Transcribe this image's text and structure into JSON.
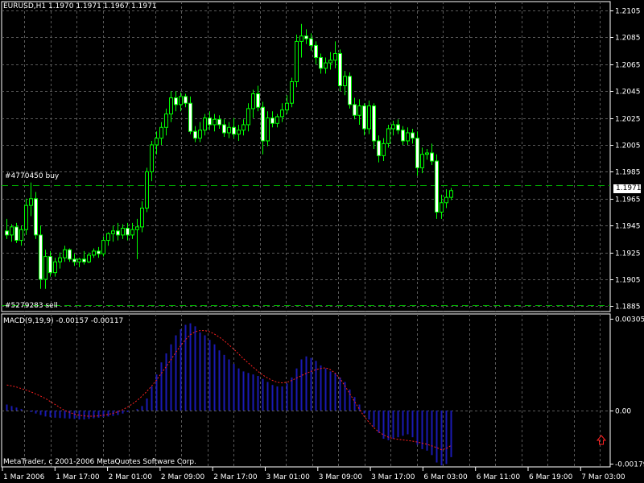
{
  "header": {
    "symbol_info": "EURUSD,H1  1.1970 1.1971 1.1967 1.1971"
  },
  "orders": {
    "buy": "#4770450 buy",
    "sell": "#5279283 sell"
  },
  "current_price": "1.1971",
  "indicator": {
    "title": "MACD(9,19,9) -0.00157 -0.00117"
  },
  "copyright": "MetaTrader, c 2001-2006 MetaQuotes Software Corp.",
  "colors": {
    "background": "#000000",
    "grid": "#5a5a5a",
    "bull_body": "#000000",
    "bear_body": "#ffffff",
    "wick": "#00ff00",
    "order_line": "#00aa00",
    "histogram": "#1a1ab4",
    "signal": "#ff2020",
    "arrow": "#ff2020"
  },
  "chart_data": [
    {
      "type": "candlestick",
      "title": "EURUSD,H1",
      "ylim": [
        1.1883,
        1.211
      ],
      "y_ticks": [
        "1.2105",
        "1.2085",
        "1.2065",
        "1.2045",
        "1.2025",
        "1.2005",
        "1.1985",
        "1.1965",
        "1.1945",
        "1.1925",
        "1.1905",
        "1.1885"
      ],
      "x_ticks": [
        "1 Mar 2006",
        "1 Mar 17:00",
        "2 Mar 01:00",
        "2 Mar 09:00",
        "2 Mar 17:00",
        "3 Mar 01:00",
        "3 Mar 09:00",
        "3 Mar 17:00",
        "6 Mar 03:00",
        "6 Mar 11:00",
        "6 Mar 19:00",
        "7 Mar 03:00"
      ],
      "order_levels": {
        "buy": 1.1975,
        "sell": 1.1886
      },
      "last_price": 1.1971,
      "candles": [
        [
          1.1941,
          1.195,
          1.1935,
          1.1938
        ],
        [
          1.1938,
          1.1946,
          1.1933,
          1.1944
        ],
        [
          1.1944,
          1.1947,
          1.1932,
          1.1934
        ],
        [
          1.1934,
          1.1945,
          1.193,
          1.1942
        ],
        [
          1.1942,
          1.1965,
          1.1938,
          1.196
        ],
        [
          1.196,
          1.1977,
          1.1952,
          1.1965
        ],
        [
          1.1965,
          1.197,
          1.1935,
          1.1938
        ],
        [
          1.1938,
          1.1945,
          1.1898,
          1.1905
        ],
        [
          1.1905,
          1.1927,
          1.1898,
          1.1922
        ],
        [
          1.1922,
          1.1926,
          1.1907,
          1.191
        ],
        [
          1.191,
          1.1921,
          1.1907,
          1.1918
        ],
        [
          1.1918,
          1.1925,
          1.1913,
          1.1921
        ],
        [
          1.1921,
          1.193,
          1.1918,
          1.1927
        ],
        [
          1.1927,
          1.1928,
          1.1918,
          1.192
        ],
        [
          1.192,
          1.1924,
          1.1915,
          1.1918
        ],
        [
          1.1918,
          1.1921,
          1.1914,
          1.192
        ],
        [
          1.192,
          1.1926,
          1.1916,
          1.1918
        ],
        [
          1.1918,
          1.1925,
          1.1917,
          1.1923
        ],
        [
          1.1923,
          1.1928,
          1.1921,
          1.1926
        ],
        [
          1.1926,
          1.1929,
          1.1921,
          1.1924
        ],
        [
          1.1924,
          1.1937,
          1.1922,
          1.1934
        ],
        [
          1.1934,
          1.194,
          1.193,
          1.1939
        ],
        [
          1.1939,
          1.1945,
          1.1933,
          1.1941
        ],
        [
          1.1941,
          1.1947,
          1.1934,
          1.1938
        ],
        [
          1.1938,
          1.1946,
          1.1935,
          1.1943
        ],
        [
          1.1943,
          1.1947,
          1.1934,
          1.1938
        ],
        [
          1.1938,
          1.1947,
          1.1935,
          1.1942
        ],
        [
          1.1942,
          1.195,
          1.192,
          1.1944
        ],
        [
          1.1944,
          1.1963,
          1.194,
          1.1958
        ],
        [
          1.1958,
          1.1988,
          1.1955,
          1.1985
        ],
        [
          1.1985,
          1.2008,
          1.1978,
          1.2005
        ],
        [
          1.2005,
          1.2015,
          1.1998,
          1.201
        ],
        [
          1.201,
          1.2022,
          1.2005,
          1.2018
        ],
        [
          1.2018,
          1.2032,
          1.2012,
          1.2028
        ],
        [
          1.2028,
          1.2045,
          1.2022,
          1.204
        ],
        [
          1.204,
          1.2045,
          1.203,
          1.2035
        ],
        [
          1.2035,
          1.2044,
          1.203,
          1.2041
        ],
        [
          1.2041,
          1.2043,
          1.2033,
          1.2036
        ],
        [
          1.2036,
          1.2041,
          1.2013,
          1.2015
        ],
        [
          1.2015,
          1.2019,
          1.2007,
          1.201
        ],
        [
          1.201,
          1.2022,
          1.2007,
          1.2016
        ],
        [
          1.2016,
          1.2028,
          1.2012,
          1.2025
        ],
        [
          1.2025,
          1.203,
          1.2016,
          1.202
        ],
        [
          1.202,
          1.2028,
          1.2015,
          1.2024
        ],
        [
          1.2024,
          1.2027,
          1.2017,
          1.202
        ],
        [
          1.202,
          1.2024,
          1.2011,
          1.2014
        ],
        [
          1.2014,
          1.2022,
          1.201,
          1.2018
        ],
        [
          1.2018,
          1.2025,
          1.201,
          1.2013
        ],
        [
          1.2013,
          1.202,
          1.2008,
          1.2016
        ],
        [
          1.2016,
          1.2024,
          1.2012,
          1.202
        ],
        [
          1.202,
          1.2036,
          1.2015,
          1.2032
        ],
        [
          1.2032,
          1.2046,
          1.2025,
          1.2043
        ],
        [
          1.2043,
          1.2049,
          1.203,
          1.2033
        ],
        [
          1.2033,
          1.2037,
          1.1998,
          1.2008
        ],
        [
          1.2008,
          1.203,
          1.2004,
          1.2025
        ],
        [
          1.2025,
          1.203,
          1.2018,
          1.2021
        ],
        [
          1.2021,
          1.2028,
          1.2018,
          1.2026
        ],
        [
          1.2026,
          1.2036,
          1.2022,
          1.2031
        ],
        [
          1.2031,
          1.2042,
          1.2028,
          1.2036
        ],
        [
          1.2036,
          1.2055,
          1.2033,
          1.2052
        ],
        [
          1.2052,
          1.2087,
          1.2048,
          1.2082
        ],
        [
          1.2082,
          1.2095,
          1.207,
          1.2086
        ],
        [
          1.2086,
          1.2091,
          1.208,
          1.2084
        ],
        [
          1.2084,
          1.2088,
          1.2075,
          1.2079
        ],
        [
          1.2079,
          1.2082,
          1.2065,
          1.207
        ],
        [
          1.207,
          1.2073,
          1.2058,
          1.2062
        ],
        [
          1.2062,
          1.207,
          1.2058,
          1.2066
        ],
        [
          1.2066,
          1.2074,
          1.2061,
          1.2068
        ],
        [
          1.2068,
          1.2082,
          1.2062,
          1.2073
        ],
        [
          1.2073,
          1.2076,
          1.2045,
          1.2049
        ],
        [
          1.2049,
          1.206,
          1.2042,
          1.2056
        ],
        [
          1.2056,
          1.2059,
          1.2032,
          1.2035
        ],
        [
          1.2035,
          1.204,
          1.2024,
          1.2027
        ],
        [
          1.2027,
          1.2039,
          1.202,
          1.2034
        ],
        [
          1.2034,
          1.2036,
          1.2012,
          1.2017
        ],
        [
          1.2017,
          1.2038,
          1.2013,
          1.2034
        ],
        [
          1.2034,
          1.2036,
          1.2002,
          1.2008
        ],
        [
          1.2008,
          1.2012,
          1.1992,
          1.1997
        ],
        [
          1.1997,
          1.201,
          1.1993,
          1.2006
        ],
        [
          1.2006,
          1.202,
          1.2003,
          1.2017
        ],
        [
          1.2017,
          1.2023,
          1.2012,
          1.202
        ],
        [
          1.202,
          1.2024,
          1.2013,
          1.2016
        ],
        [
          1.2016,
          1.2019,
          1.2005,
          1.2008
        ],
        [
          1.2008,
          1.2018,
          1.2005,
          1.2014
        ],
        [
          1.2014,
          1.2017,
          1.2006,
          1.201
        ],
        [
          1.201,
          1.2015,
          1.1982,
          1.1988
        ],
        [
          1.1988,
          1.2003,
          1.1984,
          1.1998
        ],
        [
          1.1998,
          1.2002,
          1.1994,
          1.1999
        ],
        [
          1.1999,
          1.2006,
          1.199,
          1.1993
        ],
        [
          1.1993,
          1.1998,
          1.195,
          1.1955
        ],
        [
          1.1955,
          1.1968,
          1.195,
          1.1962
        ],
        [
          1.1962,
          1.1972,
          1.1958,
          1.1966
        ],
        [
          1.1966,
          1.1973,
          1.1964,
          1.1971
        ]
      ]
    },
    {
      "type": "bar+line",
      "title": "MACD(9,19,9)",
      "ylim": [
        -0.002,
        0.00325
      ],
      "y_ticks": [
        "0.00305",
        "0.00",
        "-0.00179"
      ],
      "series": [
        {
          "name": "MACD",
          "kind": "histogram",
          "values": [
            0.0002,
            0.00015,
            0.0001,
            5e-05,
            0.0,
            -5e-05,
            -0.0001,
            -0.00015,
            -0.0002,
            -0.00022,
            -0.00024,
            -0.00025,
            -0.00026,
            -0.00027,
            -0.00028,
            -0.0003,
            -0.0003,
            -0.00028,
            -0.00026,
            -0.00024,
            -0.00022,
            -0.0002,
            -0.00018,
            -0.00015,
            -0.0001,
            -5e-05,
            0.0,
            5e-05,
            0.00015,
            0.0004,
            0.0008,
            0.0012,
            0.0016,
            0.0019,
            0.0022,
            0.0025,
            0.0027,
            0.00285,
            0.0029,
            0.0028,
            0.0026,
            0.0025,
            0.00235,
            0.0022,
            0.002,
            0.00185,
            0.0017,
            0.00155,
            0.0014,
            0.0013,
            0.00125,
            0.0012,
            0.00115,
            0.00105,
            0.00095,
            0.00085,
            0.0008,
            0.0008,
            0.0009,
            0.0011,
            0.0014,
            0.0017,
            0.0018,
            0.00175,
            0.00165,
            0.0015,
            0.0014,
            0.0013,
            0.00125,
            0.0011,
            0.00095,
            0.0007,
            0.00045,
            0.0002,
            -0.0001,
            -0.0003,
            -0.00055,
            -0.00075,
            -0.00095,
            -0.001,
            -0.00095,
            -0.0009,
            -0.00085,
            -0.0008,
            -0.0009,
            -0.00115,
            -0.0013,
            -0.00135,
            -0.0015,
            -0.00175,
            -0.00185,
            -0.0018,
            -0.00157
          ]
        },
        {
          "name": "Signal",
          "kind": "line",
          "values": [
            0.00085,
            0.00082,
            0.00078,
            0.00073,
            0.00068,
            0.00062,
            0.00055,
            0.00048,
            0.0004,
            0.0003,
            0.0002,
            0.0001,
            0.0,
            -6e-05,
            -0.00012,
            -0.00016,
            -0.00018,
            -0.00019,
            -0.00019,
            -0.00018,
            -0.00016,
            -0.00013,
            -9e-05,
            -4e-05,
            3e-05,
            0.00012,
            0.00022,
            0.00034,
            0.00048,
            0.00064,
            0.00082,
            0.00102,
            0.00124,
            0.00146,
            0.0017,
            0.00194,
            0.00216,
            0.00236,
            0.00252,
            0.00262,
            0.00266,
            0.00266,
            0.00262,
            0.00254,
            0.00244,
            0.00232,
            0.00218,
            0.00204,
            0.00188,
            0.00172,
            0.00158,
            0.00144,
            0.0013,
            0.00118,
            0.00108,
            0.001,
            0.00094,
            0.00092,
            0.00094,
            0.001,
            0.00108,
            0.00116,
            0.00124,
            0.0013,
            0.00136,
            0.0014,
            0.00142,
            0.00136,
            0.00124,
            0.00106,
            0.00082,
            0.00056,
            0.0003,
            4e-05,
            -0.0002,
            -0.0004,
            -0.00058,
            -0.00072,
            -0.00082,
            -0.0009,
            -0.00094,
            -0.00097,
            -0.00099,
            -0.00101,
            -0.00103,
            -0.00106,
            -0.0011,
            -0.00114,
            -0.00119,
            -0.00125,
            -0.00132,
            -0.00128,
            -0.00117
          ]
        }
      ]
    }
  ]
}
